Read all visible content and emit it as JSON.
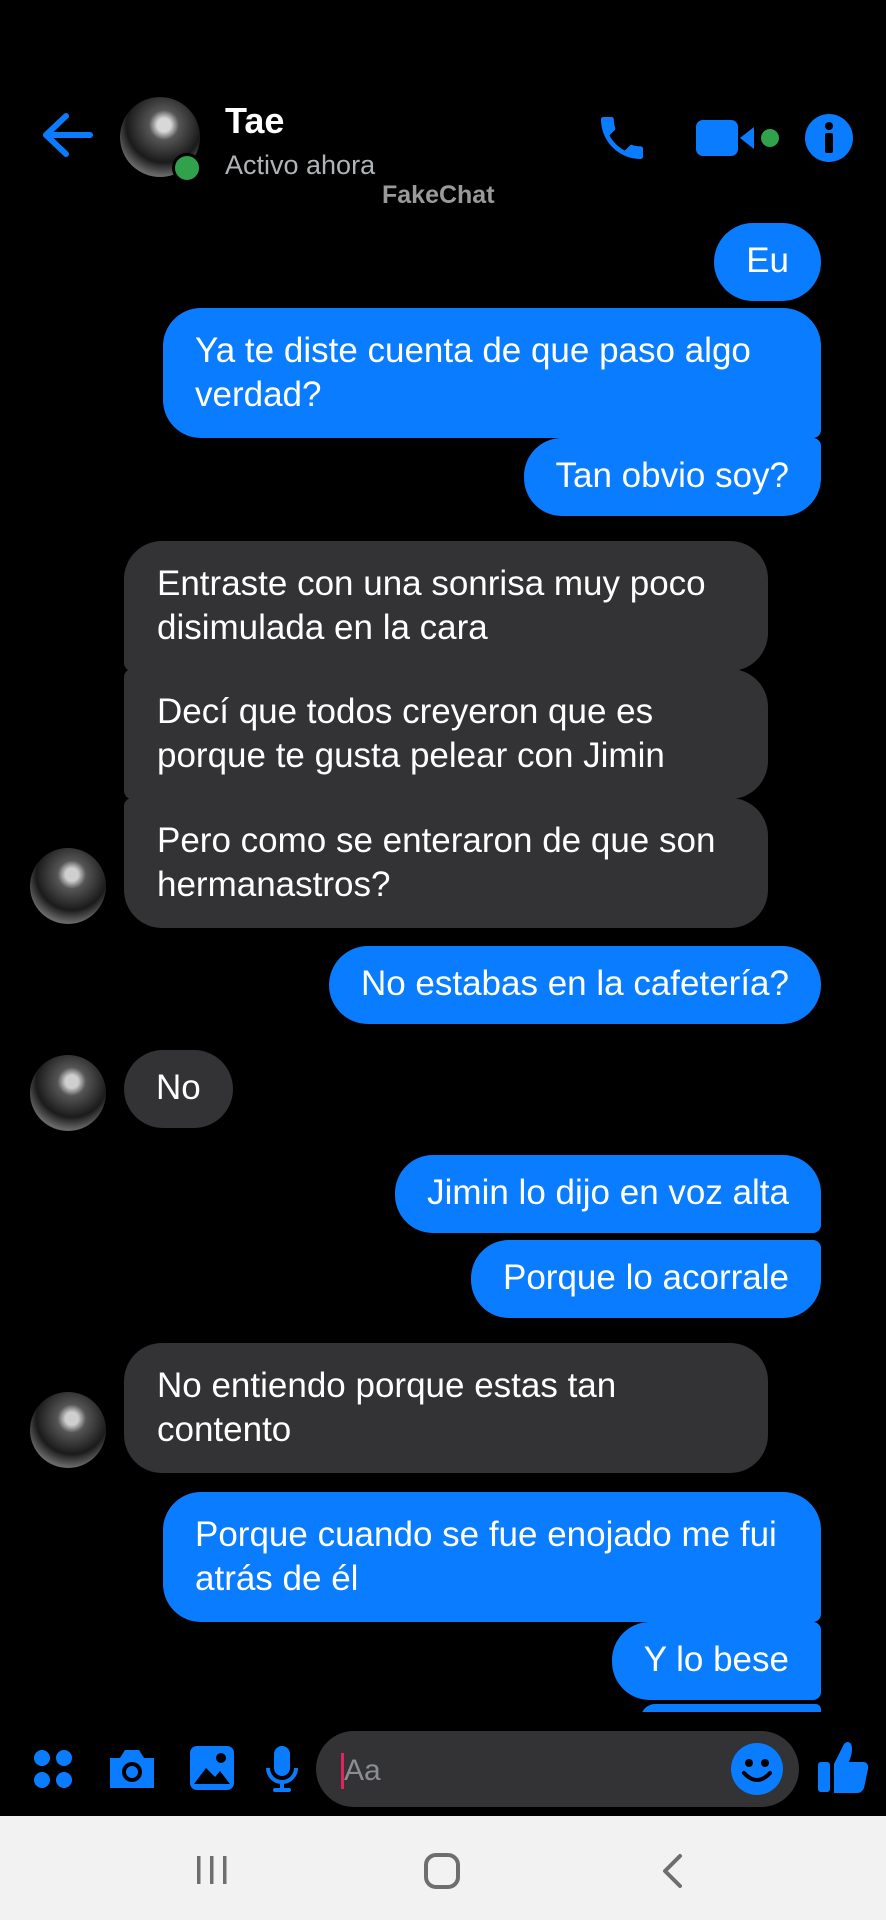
{
  "header": {
    "contact_name": "Tae",
    "status": "Activo ahora",
    "watermark": "FakeChat",
    "icons": [
      "back-arrow-icon",
      "phone-icon",
      "video-camera-icon",
      "info-icon"
    ],
    "accent": "#0a7cff"
  },
  "messages": [
    {
      "side": "out",
      "text": "Eu"
    },
    {
      "side": "out",
      "text": "Ya te diste cuenta de que paso algo verdad?"
    },
    {
      "side": "out",
      "text": "Tan obvio soy?"
    },
    {
      "side": "in",
      "text": "Entraste con una sonrisa muy poco disimulada en la cara"
    },
    {
      "side": "in",
      "text": "Decí que todos creyeron que es porque te gusta pelear con Jimin"
    },
    {
      "side": "in",
      "text": "Pero como se enteraron de que son hermanastros?"
    },
    {
      "side": "out",
      "text": "No estabas en la cafetería?"
    },
    {
      "side": "in",
      "text": "No"
    },
    {
      "side": "out",
      "text": "Jimin lo dijo en voz alta"
    },
    {
      "side": "out",
      "text": "Porque lo acorrale"
    },
    {
      "side": "in",
      "text": "No entiendo porque estas tan contento"
    },
    {
      "side": "out",
      "text": "Porque cuando se fue enojado me fui atrás de él"
    },
    {
      "side": "out",
      "text": "Y lo bese"
    }
  ],
  "composer": {
    "placeholder": "Aa",
    "icons": [
      "apps-grid-icon",
      "camera-icon",
      "gallery-icon",
      "microphone-icon",
      "emoji-icon",
      "thumbs-up-icon"
    ]
  },
  "navbar": {
    "icons": [
      "recent-apps-icon",
      "home-icon",
      "back-icon"
    ]
  },
  "colors": {
    "outgoing_bubble": "#0a7cff",
    "incoming_bubble": "#333335",
    "background": "#000000",
    "online": "#31a24c"
  }
}
